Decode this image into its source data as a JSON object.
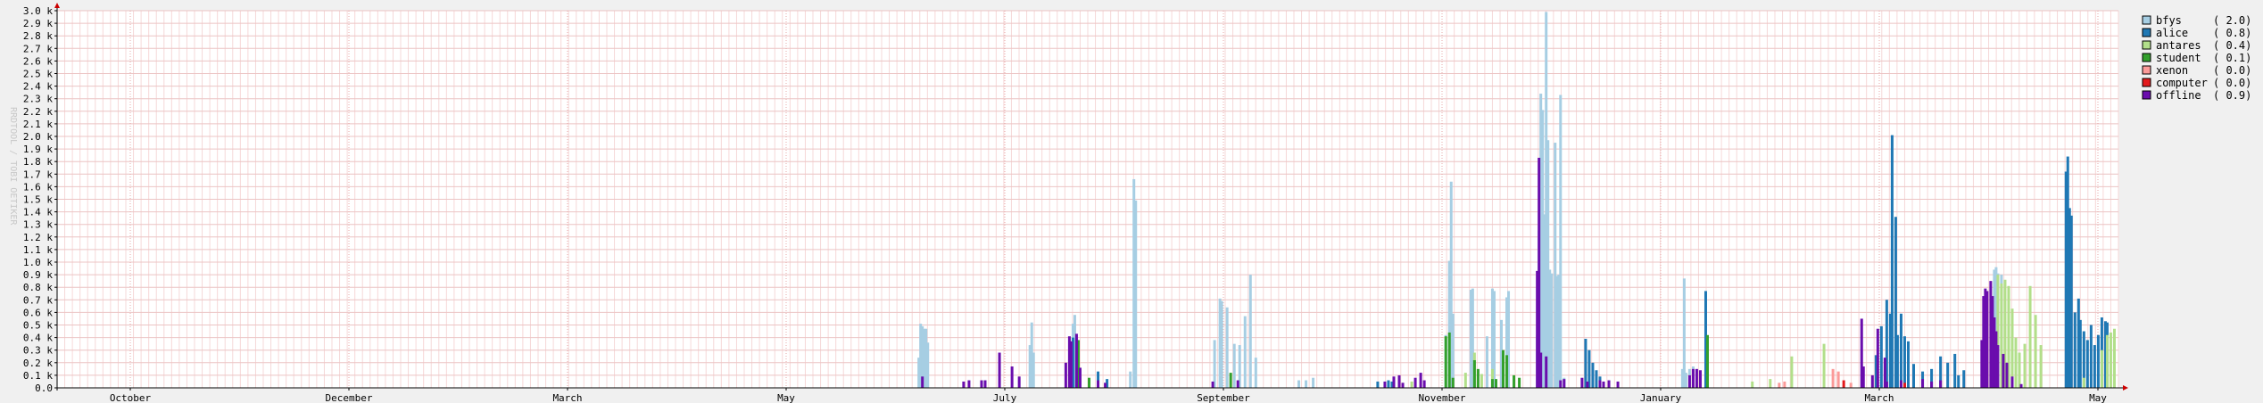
{
  "chart_data": {
    "type": "bar",
    "stacked": false,
    "side_label": "RRDTOOL / TOBI OETIKER",
    "ylim": [
      0,
      3.0
    ],
    "y_unit_suffix": " k",
    "y_ticks": [
      "0.0",
      "0.1 k",
      "0.2 k",
      "0.3 k",
      "0.4 k",
      "0.5 k",
      "0.6 k",
      "0.7 k",
      "0.8 k",
      "0.9 k",
      "1.0 k",
      "1.1 k",
      "1.2 k",
      "1.3 k",
      "1.4 k",
      "1.5 k",
      "1.6 k",
      "1.7 k",
      "1.8 k",
      "1.9 k",
      "2.0 k",
      "2.1 k",
      "2.2 k",
      "2.3 k",
      "2.4 k",
      "2.5 k",
      "2.6 k",
      "2.7 k",
      "2.8 k",
      "2.9 k",
      "3.0 k"
    ],
    "x_ticks": [
      "October",
      "December",
      "March",
      "May",
      "July",
      "September",
      "November",
      "January",
      "March",
      "May"
    ],
    "grid": true,
    "legend_position": "right",
    "series": [
      {
        "name": "bfys",
        "legend_value": "( 2.0)",
        "color": "#a6cee3",
        "points": [
          [
            0.48,
            0.24
          ],
          [
            0.481,
            0.51
          ],
          [
            0.482,
            0.49
          ],
          [
            0.483,
            0.47
          ],
          [
            0.484,
            0.47
          ],
          [
            0.485,
            0.36
          ],
          [
            0.542,
            0.34
          ],
          [
            0.543,
            0.52
          ],
          [
            0.544,
            0.28
          ],
          [
            0.566,
            0.51
          ],
          [
            0.567,
            0.58
          ],
          [
            0.57,
            0.13
          ],
          [
            0.598,
            0.13
          ],
          [
            0.6,
            1.66
          ],
          [
            0.601,
            1.49
          ],
          [
            0.645,
            0.38
          ],
          [
            0.648,
            0.71
          ],
          [
            0.649,
            0.69
          ],
          [
            0.652,
            0.64
          ],
          [
            0.656,
            0.35
          ],
          [
            0.659,
            0.34
          ],
          [
            0.662,
            0.57
          ],
          [
            0.665,
            0.9
          ],
          [
            0.668,
            0.24
          ],
          [
            0.692,
            0.06
          ],
          [
            0.696,
            0.06
          ],
          [
            0.7,
            0.08
          ],
          [
            0.774,
            0.42
          ],
          [
            0.776,
            1.01
          ],
          [
            0.777,
            1.64
          ],
          [
            0.778,
            0.59
          ],
          [
            0.788,
            0.78
          ],
          [
            0.789,
            0.79
          ],
          [
            0.797,
            0.41
          ],
          [
            0.8,
            0.79
          ],
          [
            0.801,
            0.77
          ],
          [
            0.805,
            0.54
          ],
          [
            0.808,
            0.72
          ],
          [
            0.809,
            0.77
          ],
          [
            0.825,
            0.42
          ],
          [
            0.826,
            1.25
          ],
          [
            0.827,
            2.34
          ],
          [
            0.828,
            2.21
          ],
          [
            0.829,
            1.38
          ],
          [
            0.83,
            2.99
          ],
          [
            0.831,
            1.97
          ],
          [
            0.832,
            0.94
          ],
          [
            0.833,
            0.91
          ],
          [
            0.835,
            1.95
          ],
          [
            0.836,
            0.89
          ],
          [
            0.837,
            0.9
          ],
          [
            0.838,
            2.33
          ],
          [
            0.84,
            0.08
          ],
          [
            0.906,
            0.15
          ],
          [
            0.907,
            0.87
          ],
          [
            0.908,
            0.12
          ],
          [
            0.91,
            0.15
          ],
          [
            0.912,
            0.17
          ],
          [
            1.08,
            0.94
          ],
          [
            1.081,
            0.96
          ],
          [
            1.082,
            0.91
          ],
          [
            1.084,
            0.9
          ],
          [
            1.09,
            0.41
          ],
          [
            1.092,
            0.38
          ]
        ]
      },
      {
        "name": "alice",
        "legend_value": "( 0.8)",
        "color": "#1f78b4",
        "points": [
          [
            0.566,
            0.4
          ],
          [
            0.568,
            0.38
          ],
          [
            0.58,
            0.13
          ],
          [
            0.585,
            0.07
          ],
          [
            0.736,
            0.05
          ],
          [
            0.742,
            0.06
          ],
          [
            0.744,
            0.05
          ],
          [
            0.748,
            0.06
          ],
          [
            0.852,
            0.39
          ],
          [
            0.854,
            0.3
          ],
          [
            0.856,
            0.2
          ],
          [
            0.858,
            0.14
          ],
          [
            0.86,
            0.09
          ],
          [
            0.919,
            0.77
          ],
          [
            0.92,
            0.38
          ],
          [
            1.014,
            0.26
          ],
          [
            1.017,
            0.49
          ],
          [
            1.02,
            0.7
          ],
          [
            1.022,
            0.59
          ],
          [
            1.023,
            2.01
          ],
          [
            1.025,
            1.36
          ],
          [
            1.026,
            0.42
          ],
          [
            1.028,
            0.59
          ],
          [
            1.03,
            0.41
          ],
          [
            1.032,
            0.37
          ],
          [
            1.035,
            0.19
          ],
          [
            1.04,
            0.13
          ],
          [
            1.045,
            0.15
          ],
          [
            1.05,
            0.25
          ],
          [
            1.054,
            0.2
          ],
          [
            1.058,
            0.27
          ],
          [
            1.06,
            0.1
          ],
          [
            1.063,
            0.14
          ],
          [
            1.12,
            1.72
          ],
          [
            1.121,
            1.84
          ],
          [
            1.122,
            1.43
          ],
          [
            1.123,
            1.37
          ],
          [
            1.125,
            0.6
          ],
          [
            1.127,
            0.71
          ],
          [
            1.128,
            0.54
          ],
          [
            1.13,
            0.45
          ],
          [
            1.132,
            0.38
          ],
          [
            1.134,
            0.5
          ],
          [
            1.136,
            0.34
          ],
          [
            1.138,
            0.42
          ],
          [
            1.14,
            0.56
          ],
          [
            1.142,
            0.53
          ],
          [
            1.143,
            0.52
          ]
        ]
      },
      {
        "name": "antares",
        "legend_value": "( 0.4)",
        "color": "#b2df8a",
        "points": [
          [
            0.75,
            0.04
          ],
          [
            0.755,
            0.05
          ],
          [
            0.785,
            0.12
          ],
          [
            0.79,
            0.28
          ],
          [
            0.794,
            0.11
          ],
          [
            0.8,
            0.15
          ],
          [
            0.945,
            0.05
          ],
          [
            0.955,
            0.07
          ],
          [
            0.967,
            0.25
          ],
          [
            0.985,
            0.35
          ],
          [
            1.082,
            0.9
          ],
          [
            1.084,
            0.83
          ],
          [
            1.086,
            0.86
          ],
          [
            1.088,
            0.81
          ],
          [
            1.09,
            0.63
          ],
          [
            1.092,
            0.4
          ],
          [
            1.094,
            0.28
          ],
          [
            1.097,
            0.35
          ],
          [
            1.1,
            0.81
          ],
          [
            1.103,
            0.58
          ],
          [
            1.106,
            0.34
          ],
          [
            1.13,
            0.08
          ],
          [
            1.14,
            0.3
          ],
          [
            1.143,
            0.42
          ],
          [
            1.145,
            0.44
          ],
          [
            1.147,
            0.47
          ]
        ]
      },
      {
        "name": "student",
        "legend_value": "( 0.1)",
        "color": "#33a02c",
        "points": [
          [
            0.569,
            0.38
          ],
          [
            0.575,
            0.08
          ],
          [
            0.654,
            0.12
          ],
          [
            0.774,
            0.41
          ],
          [
            0.776,
            0.44
          ],
          [
            0.778,
            0.08
          ],
          [
            0.79,
            0.22
          ],
          [
            0.792,
            0.15
          ],
          [
            0.8,
            0.07
          ],
          [
            0.802,
            0.07
          ],
          [
            0.806,
            0.3
          ],
          [
            0.808,
            0.26
          ],
          [
            0.812,
            0.1
          ],
          [
            0.815,
            0.08
          ],
          [
            0.92,
            0.42
          ],
          [
            0.92,
            0.41
          ]
        ]
      },
      {
        "name": "xenon",
        "legend_value": "( 0.0)",
        "color": "#fb9a99",
        "points": [
          [
            0.96,
            0.04
          ],
          [
            0.963,
            0.05
          ],
          [
            0.99,
            0.15
          ],
          [
            0.993,
            0.13
          ],
          [
            1.0,
            0.04
          ]
        ]
      },
      {
        "name": "computer",
        "legend_value": "( 0.0)",
        "color": "#e31a1c",
        "points": [
          [
            0.996,
            0.06
          ],
          [
            1.03,
            0.04
          ]
        ]
      },
      {
        "name": "offline",
        "legend_value": "( 0.9)",
        "color": "#6a0dad",
        "points": [
          [
            0.482,
            0.09
          ],
          [
            0.505,
            0.05
          ],
          [
            0.508,
            0.06
          ],
          [
            0.515,
            0.06
          ],
          [
            0.517,
            0.06
          ],
          [
            0.525,
            0.28
          ],
          [
            0.532,
            0.17
          ],
          [
            0.536,
            0.09
          ],
          [
            0.562,
            0.2
          ],
          [
            0.564,
            0.41
          ],
          [
            0.565,
            0.37
          ],
          [
            0.568,
            0.43
          ],
          [
            0.57,
            0.16
          ],
          [
            0.58,
            0.06
          ],
          [
            0.584,
            0.04
          ],
          [
            0.644,
            0.05
          ],
          [
            0.658,
            0.06
          ],
          [
            0.74,
            0.05
          ],
          [
            0.745,
            0.09
          ],
          [
            0.748,
            0.1
          ],
          [
            0.75,
            0.04
          ],
          [
            0.757,
            0.08
          ],
          [
            0.76,
            0.12
          ],
          [
            0.762,
            0.06
          ],
          [
            0.825,
            0.93
          ],
          [
            0.826,
            1.83
          ],
          [
            0.827,
            0.28
          ],
          [
            0.83,
            0.25
          ],
          [
            0.838,
            0.06
          ],
          [
            0.84,
            0.07
          ],
          [
            0.85,
            0.08
          ],
          [
            0.853,
            0.05
          ],
          [
            0.86,
            0.06
          ],
          [
            0.862,
            0.05
          ],
          [
            0.865,
            0.06
          ],
          [
            0.87,
            0.05
          ],
          [
            0.91,
            0.1
          ],
          [
            0.912,
            0.15
          ],
          [
            0.914,
            0.15
          ],
          [
            0.916,
            0.14
          ],
          [
            1.006,
            0.55
          ],
          [
            1.007,
            0.17
          ],
          [
            1.012,
            0.1
          ],
          [
            1.015,
            0.47
          ],
          [
            1.019,
            0.24
          ],
          [
            1.02,
            0.05
          ],
          [
            1.028,
            0.06
          ],
          [
            1.04,
            0.07
          ],
          [
            1.045,
            0.05
          ],
          [
            1.05,
            0.06
          ],
          [
            1.073,
            0.38
          ],
          [
            1.074,
            0.73
          ],
          [
            1.075,
            0.79
          ],
          [
            1.076,
            0.77
          ],
          [
            1.078,
            0.85
          ],
          [
            1.079,
            0.73
          ],
          [
            1.08,
            0.56
          ],
          [
            1.081,
            0.45
          ],
          [
            1.082,
            0.34
          ],
          [
            1.085,
            0.27
          ],
          [
            1.087,
            0.2
          ],
          [
            1.09,
            0.09
          ],
          [
            1.095,
            0.03
          ]
        ]
      }
    ]
  }
}
